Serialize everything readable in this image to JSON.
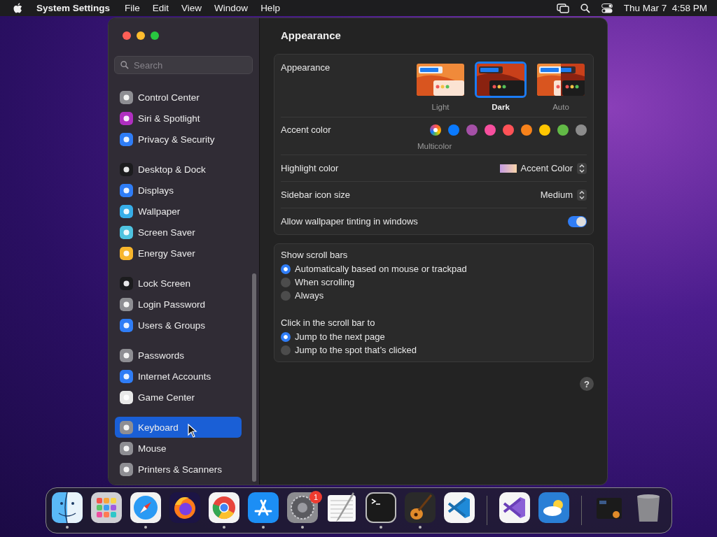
{
  "menubar": {
    "app": "System Settings",
    "menus": [
      "File",
      "Edit",
      "View",
      "Window",
      "Help"
    ],
    "clock": "Thu Mar 7  4:58 PM"
  },
  "window": {
    "title": "Appearance",
    "search": {
      "placeholder": "Search"
    },
    "sidebar": [
      [
        {
          "label": "Control Center",
          "color": "#8e8e93",
          "selected": false
        },
        {
          "label": "Siri & Spotlight",
          "color": "#b02fc0",
          "selected": false
        },
        {
          "label": "Privacy & Security",
          "color": "#2f7df6",
          "selected": false
        }
      ],
      [
        {
          "label": "Desktop & Dock",
          "color": "#1c1c1e",
          "selected": false
        },
        {
          "label": "Displays",
          "color": "#2f7df6",
          "selected": false
        },
        {
          "label": "Wallpaper",
          "color": "#37aee8",
          "selected": false
        },
        {
          "label": "Screen Saver",
          "color": "#4fc3e0",
          "selected": false
        },
        {
          "label": "Energy Saver",
          "color": "#f7b52c",
          "selected": false
        }
      ],
      [
        {
          "label": "Lock Screen",
          "color": "#1c1c1e",
          "selected": false
        },
        {
          "label": "Login Password",
          "color": "#8e8e93",
          "selected": false
        },
        {
          "label": "Users & Groups",
          "color": "#2f7df6",
          "selected": false
        }
      ],
      [
        {
          "label": "Passwords",
          "color": "#8e8e93",
          "selected": false
        },
        {
          "label": "Internet Accounts",
          "color": "#2f7df6",
          "selected": false
        },
        {
          "label": "Game Center",
          "color": "#e8e8e8",
          "selected": false
        }
      ],
      [
        {
          "label": "Keyboard",
          "color": "#8e8e93",
          "selected": true
        },
        {
          "label": "Mouse",
          "color": "#8e8e93",
          "selected": false
        },
        {
          "label": "Printers & Scanners",
          "color": "#8e8e93",
          "selected": false
        }
      ]
    ],
    "scroll_groups": [
      {
        "label": "Show scroll bars",
        "options": [
          {
            "label": "Automatically based on mouse or trackpad",
            "selected": true
          },
          {
            "label": "When scrolling",
            "selected": false
          },
          {
            "label": "Always",
            "selected": false
          }
        ]
      },
      {
        "label": "Click in the scroll bar to",
        "options": [
          {
            "label": "Jump to the next page",
            "selected": true
          },
          {
            "label": "Jump to the spot that’s clicked",
            "selected": false
          }
        ]
      }
    ],
    "help": "?"
  },
  "appearance": {
    "label": "Appearance",
    "options": [
      {
        "label": "Light",
        "kind": "light",
        "selected": false
      },
      {
        "label": "Dark",
        "kind": "dark",
        "selected": true
      },
      {
        "label": "Auto",
        "kind": "auto",
        "selected": false
      }
    ]
  },
  "accent": {
    "label": "Accent color",
    "selected_label": "Multicolor",
    "colors": [
      {
        "kind": "multicolor",
        "selected": true
      },
      {
        "kind": "solid",
        "color": "#0a7aff",
        "selected": false
      },
      {
        "kind": "solid",
        "color": "#a550a7",
        "selected": false
      },
      {
        "kind": "solid",
        "color": "#f74f9e",
        "selected": false
      },
      {
        "kind": "solid",
        "color": "#ff5257",
        "selected": false
      },
      {
        "kind": "solid",
        "color": "#f7821b",
        "selected": false
      },
      {
        "kind": "solid",
        "color": "#ffc600",
        "selected": false
      },
      {
        "kind": "solid",
        "color": "#62ba46",
        "selected": false
      },
      {
        "kind": "solid",
        "color": "#8c8c8c",
        "selected": false
      }
    ]
  },
  "highlight": {
    "label": "Highlight color",
    "value": "Accent Color"
  },
  "icon_size": {
    "label": "Sidebar icon size",
    "value": "Medium"
  },
  "tinting": {
    "label": "Allow wallpaper tinting in windows",
    "on": true
  },
  "dock": [
    [
      {
        "kind": "finder",
        "running": true
      },
      {
        "kind": "launchpad",
        "running": false
      },
      {
        "kind": "safari",
        "running": true
      },
      {
        "kind": "firefox",
        "running": false
      },
      {
        "kind": "chrome",
        "running": true
      },
      {
        "kind": "appstore",
        "running": true
      },
      {
        "kind": "settings",
        "running": true,
        "badge": "1"
      },
      {
        "kind": "textedit",
        "running": false
      },
      {
        "kind": "terminal",
        "running": true
      },
      {
        "kind": "guitar",
        "running": true
      },
      {
        "kind": "vscode",
        "running": false
      }
    ],
    [
      {
        "kind": "vstudio",
        "running": false
      },
      {
        "kind": "weather",
        "running": false
      }
    ],
    [
      {
        "kind": "downloads",
        "running": false
      },
      {
        "kind": "trash",
        "running": false
      }
    ]
  ]
}
